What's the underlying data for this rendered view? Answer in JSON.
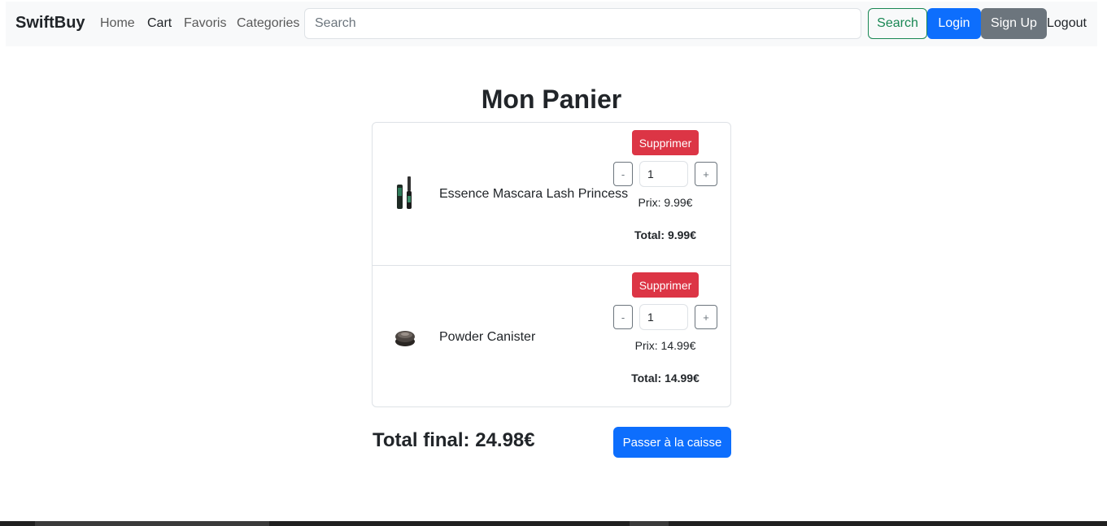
{
  "navbar": {
    "brand": "SwiftBuy",
    "links": [
      "Home",
      "Cart",
      "Favoris",
      "Categories"
    ],
    "search_placeholder": "Search",
    "search_button": "Search",
    "login_button": "Login",
    "signup_button": "Sign Up",
    "logout_link": "Logout"
  },
  "cart": {
    "title": "Mon Panier",
    "items": [
      {
        "name": "Essence Mascara Lash Princess",
        "delete_label": "Supprimer",
        "minus_label": "-",
        "plus_label": "+",
        "quantity": "1",
        "price_text": "Prix: 9.99€",
        "total_text": "Total: 9.99€"
      },
      {
        "name": "Powder Canister",
        "delete_label": "Supprimer",
        "minus_label": "-",
        "plus_label": "+",
        "quantity": "1",
        "price_text": "Prix: 14.99€",
        "total_text": "Total: 14.99€"
      }
    ],
    "final_total_text": "Total final: 24.98€",
    "checkout_label": "Passer à la caisse"
  },
  "colors": {
    "primary": "#0d6efd",
    "danger": "#dc3545",
    "success": "#198754",
    "secondary": "#6c757d",
    "navbar_bg": "#f8f9fa"
  }
}
